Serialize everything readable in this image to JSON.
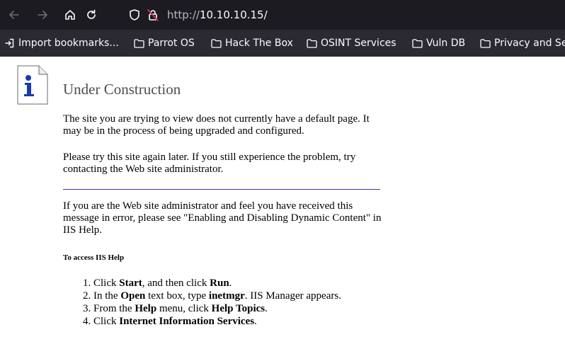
{
  "browser": {
    "url": "http://10.10.10.15/",
    "url_protocol": "http://",
    "url_host": "10.10.10.15/",
    "bookmarks": [
      {
        "label": "Import bookmarks...",
        "icon": "import-icon"
      },
      {
        "label": "Parrot OS",
        "icon": "folder-icon"
      },
      {
        "label": "Hack The Box",
        "icon": "folder-icon"
      },
      {
        "label": "OSINT Services",
        "icon": "folder-icon"
      },
      {
        "label": "Vuln DB",
        "icon": "folder-icon"
      },
      {
        "label": "Privacy and Security",
        "icon": "folder-icon"
      }
    ]
  },
  "page": {
    "title": "Under Construction",
    "para1": "The site you are trying to view does not currently have a default page. It may be in the process of being upgraded and configured.",
    "para2": "Please try this site again later. If you still experience the problem, try contacting the Web site administrator.",
    "para3": "If you are the Web site administrator and feel you have received this message in error, please see \"Enabling and Disabling Dynamic Content\" in IIS Help.",
    "help_heading": "To access IIS Help",
    "steps": [
      {
        "n": "1.",
        "a": "Click ",
        "b1": "Start",
        "c": ", and then click ",
        "b2": "Run",
        "d": "."
      },
      {
        "n": "2.",
        "a": "In the ",
        "b1": "Open",
        "c": " text box, type ",
        "b2": "inetmgr",
        "d": ". IIS Manager appears."
      },
      {
        "n": "3.",
        "a": "From the ",
        "b1": "Help",
        "c": " menu, click ",
        "b2": "Help Topics",
        "d": "."
      },
      {
        "n": "4.",
        "a": "Click ",
        "b1": "Internet Information Services",
        "c": "",
        "b2": "",
        "d": "."
      }
    ]
  },
  "colors": {
    "toolbar_bg": "#1c1b22",
    "bookmarks_bg": "#2b2a33",
    "lock_warning": "#e22850",
    "divider": "#3a3aa8",
    "info_icon": "#1a3ab0"
  }
}
